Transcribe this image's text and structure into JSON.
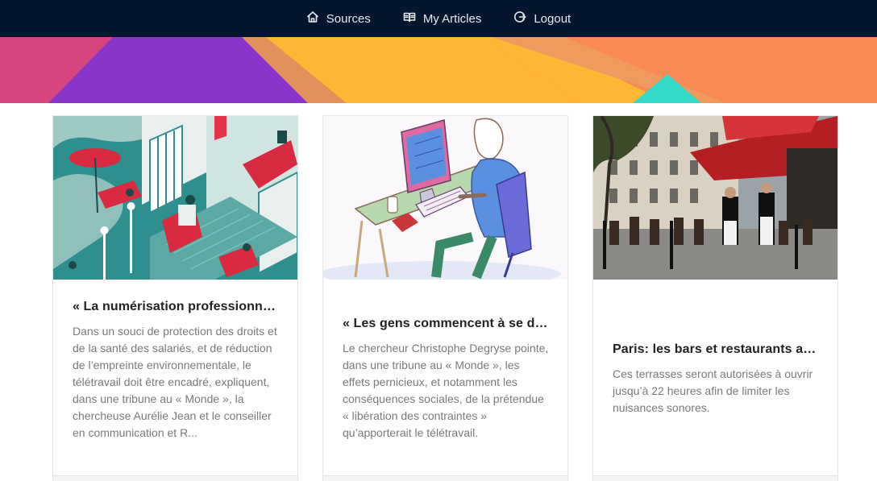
{
  "nav": {
    "items": [
      {
        "label": "Sources",
        "icon": "home-icon"
      },
      {
        "label": "My Articles",
        "icon": "book-icon"
      },
      {
        "label": "Logout",
        "icon": "logout-icon"
      }
    ]
  },
  "colors": {
    "nav_bg": "#04152d",
    "banner": [
      "#d6457d",
      "#8a35c9",
      "#fdb735",
      "#f98b57",
      "#35dac9"
    ]
  },
  "articles": [
    {
      "title": "« La numérisation professionnell...",
      "excerpt": "Dans un souci de protection des droits et de la santé des salariés, et de réduction de l’empreinte environnementale, le télétravail doit être encadré, expliquent, dans une tribune au « Monde », la chercheuse Aurélie Jean et le conseiller en communication et R...",
      "image": "isometric-telework-illustration"
    },
    {
      "title": "« Les gens commencent à se de...",
      "excerpt": "Le chercheur Christophe Degryse pointe, dans une tribune au « Monde », les effets pernicieux, et notamment les conséquences sociales, de la prétendue « libération des contraintes » qu’apporterait le télétravail.",
      "image": "man-at-computer-illustration"
    },
    {
      "title": "Paris: les bars et restaurants aut...",
      "excerpt": "Ces terrasses seront autorisées à ouvrir jusqu’à 22 heures afin de limiter les nuisances sonores.",
      "image": "paris-cafe-terrace-photo"
    }
  ]
}
